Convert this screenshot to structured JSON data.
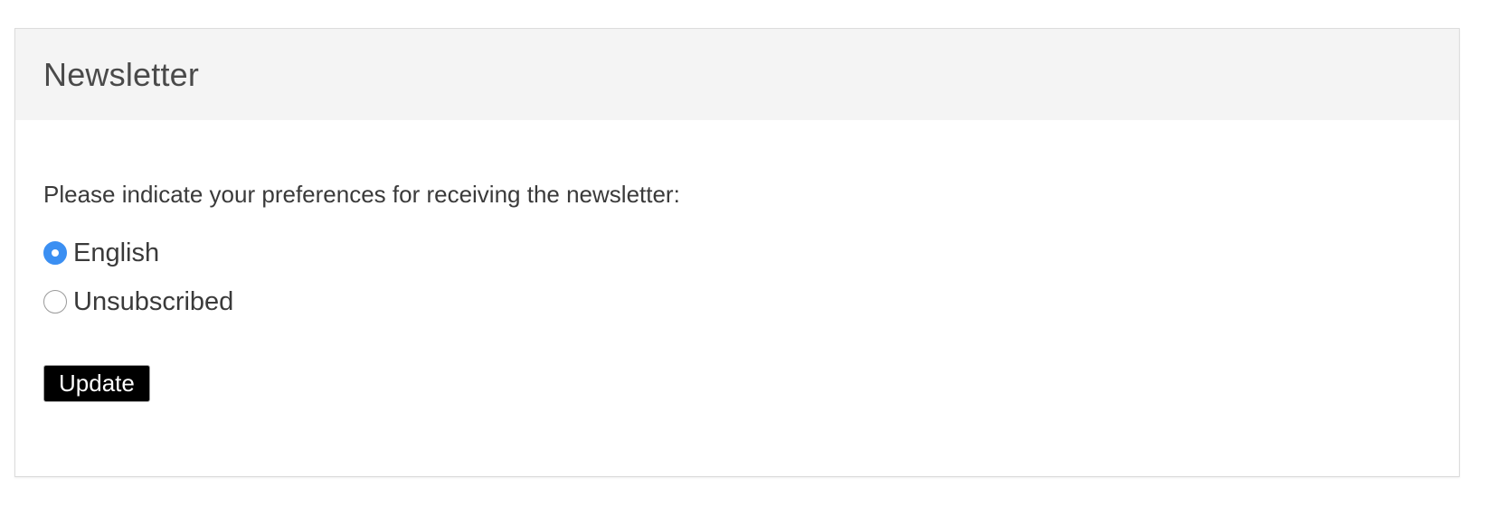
{
  "panel": {
    "title": "Newsletter",
    "prompt": "Please indicate your preferences for receiving the newsletter:",
    "options": [
      {
        "label": "English",
        "selected": true
      },
      {
        "label": "Unsubscribed",
        "selected": false
      }
    ],
    "update_label": "Update"
  },
  "colors": {
    "accent": "#3b8ff2",
    "header_bg": "#f4f4f4",
    "button_bg": "#000000"
  }
}
